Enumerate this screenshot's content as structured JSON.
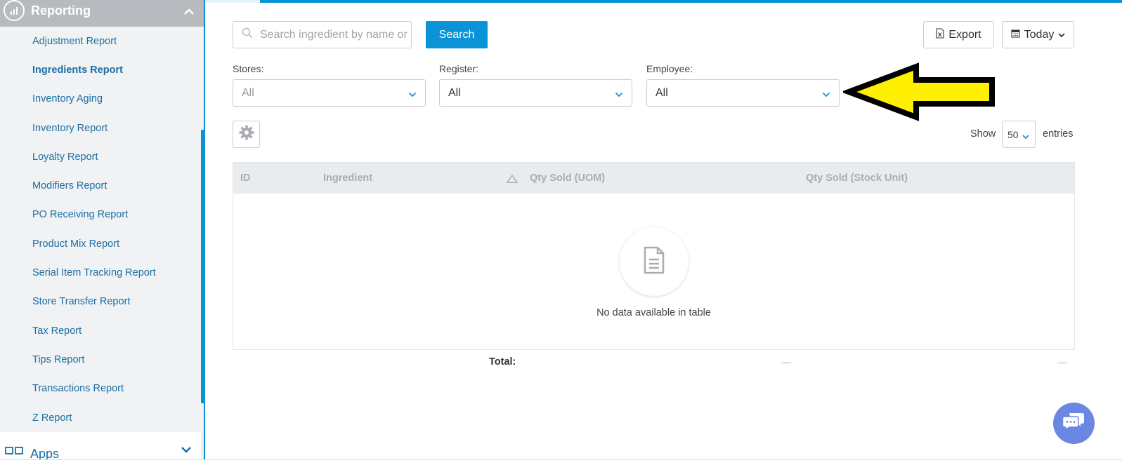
{
  "sidebar": {
    "header": "Reporting",
    "items": [
      {
        "label": "Adjustment Report"
      },
      {
        "label": "Ingredients Report"
      },
      {
        "label": "Inventory Aging"
      },
      {
        "label": "Inventory Report"
      },
      {
        "label": "Loyalty Report"
      },
      {
        "label": "Modifiers Report"
      },
      {
        "label": "PO Receiving Report"
      },
      {
        "label": "Product Mix Report"
      },
      {
        "label": "Serial Item Tracking Report"
      },
      {
        "label": "Store Transfer Report"
      },
      {
        "label": "Tax Report"
      },
      {
        "label": "Tips Report"
      },
      {
        "label": "Transactions Report"
      },
      {
        "label": "Z Report"
      }
    ],
    "active_item": "Ingredients Report",
    "apps_label": "Apps"
  },
  "toolbar": {
    "search_placeholder": "Search ingredient by name or ID",
    "search_button": "Search",
    "export_button": "Export",
    "date_button": "Today"
  },
  "filters": {
    "stores": {
      "label": "Stores:",
      "value": "All"
    },
    "register": {
      "label": "Register:",
      "value": "All"
    },
    "employee": {
      "label": "Employee:",
      "value": "All"
    }
  },
  "table": {
    "show_label": "Show",
    "entries_value": "50",
    "entries_label": "entries",
    "columns": [
      "ID",
      "Ingredient",
      "Qty Sold (UOM)",
      "Qty Sold (Stock Unit)"
    ],
    "empty_message": "No data available in table",
    "total_label": "Total:",
    "total_uom": "—",
    "total_stock": "—"
  },
  "colors": {
    "accent": "#0b93d8",
    "sidebar_bg": "#f0f2f4",
    "header_bg": "#b7babe",
    "arrow_fill": "#ffef00",
    "chat_bg": "#6c87e3"
  }
}
